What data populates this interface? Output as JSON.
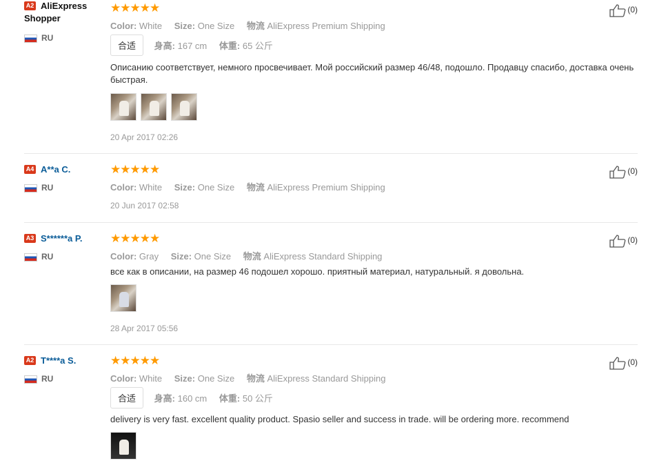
{
  "reviews": [
    {
      "badge": "A2",
      "name": "AliExpress Shopper",
      "country": "RU",
      "stars": "★★★★★",
      "color_label": "Color:",
      "color": "White",
      "size_label": "Size:",
      "size": "One Size",
      "shipping_label": "物流",
      "shipping": "AliExpress Premium Shipping",
      "fit": "合适",
      "height_label": "身高:",
      "height": "167 cm",
      "weight_label": "体重:",
      "weight": "65 公斤",
      "text": "Описанию соответствует, немного просвечивает. Мой российский размер 46/48, подошло. Продавцу спасибо, доставка очень быстрая.",
      "date": "20 Apr 2017 02:26",
      "likes": "(0)"
    },
    {
      "badge": "A4",
      "name": "A**a C.",
      "country": "RU",
      "stars": "★★★★★",
      "color_label": "Color:",
      "color": "White",
      "size_label": "Size:",
      "size": "One Size",
      "shipping_label": "物流",
      "shipping": "AliExpress Premium Shipping",
      "date": "20 Jun 2017 02:58",
      "likes": "(0)"
    },
    {
      "badge": "A3",
      "name": "S******a P.",
      "country": "RU",
      "stars": "★★★★★",
      "color_label": "Color:",
      "color": "Gray",
      "size_label": "Size:",
      "size": "One Size",
      "shipping_label": "物流",
      "shipping": "AliExpress Standard Shipping",
      "text": "все как в описании, на размер 46 подошел хорошо. приятный материал, натуральный. я довольна.",
      "date": "28 Apr 2017 05:56",
      "likes": "(0)"
    },
    {
      "badge": "A2",
      "name": "T****a S.",
      "country": "RU",
      "stars": "★★★★★",
      "color_label": "Color:",
      "color": "White",
      "size_label": "Size:",
      "size": "One Size",
      "shipping_label": "物流",
      "shipping": "AliExpress Standard Shipping",
      "fit": "合适",
      "height_label": "身高:",
      "height": "160 cm",
      "weight_label": "体重:",
      "weight": "50 公斤",
      "text": "delivery is very fast. excellent quality product. Spasio seller and success in trade. will be ordering more. recommend",
      "likes": "(0)"
    }
  ],
  "colors": {
    "star": "#ff9a00",
    "badge": "#d9391b",
    "name": "#0a5c98"
  },
  "icons": {
    "like": "thumbs-up-icon",
    "flag": "russia-flag-icon"
  }
}
